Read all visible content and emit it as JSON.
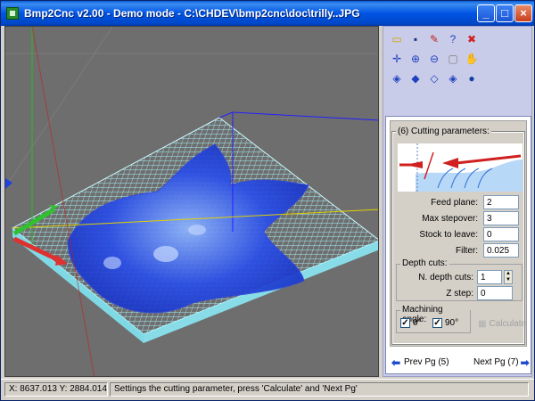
{
  "window": {
    "title": "Bmp2Cnc v2.00 - Demo mode - C:\\CHDEV\\bmp2cnc\\doc\\trilly..JPG",
    "min_icon": "minimize-icon",
    "max_icon": "maximize-icon",
    "close_icon": "close-icon"
  },
  "toolbar": {
    "row1": [
      "open-folder-icon",
      "save-icon",
      "wand-icon",
      "help-icon",
      "stop-icon"
    ],
    "row2": [
      "center-icon",
      "zoom-in-icon",
      "zoom-out-icon",
      "zoom-window-icon",
      "pan-hand-icon"
    ],
    "row3": [
      "view-cube-1-icon",
      "view-cube-2-icon",
      "view-cube-3-icon",
      "view-cube-4-icon",
      "sphere-icon"
    ]
  },
  "params": {
    "title": "(6) Cutting parameters:",
    "feed_plane_label": "Feed plane:",
    "feed_plane_value": "2",
    "max_stepover_label": "Max stepover:",
    "max_stepover_value": "3",
    "stock_label": "Stock to leave:",
    "stock_value": "0",
    "filter_label": "Filter:",
    "filter_value": "0.025",
    "depth_group": "Depth cuts:",
    "n_depth_label": "N. depth cuts:",
    "n_depth_value": "1",
    "z_step_label": "Z step:",
    "z_step_value": "0",
    "angle_group": "Machining angle:",
    "angle_0_label": "0°",
    "angle_90_label": "90°",
    "angle_0_checked": true,
    "angle_90_checked": true,
    "calculate_label": "Calculate"
  },
  "nav": {
    "prev_label": "Prev Pg (5)",
    "next_label": "Next Pg (7)"
  },
  "status": {
    "coords": "X: 8637.013 Y: 2884.014",
    "message": "Settings the cutting parameter, press 'Calculate' and 'Next Pg'"
  },
  "colors": {
    "titlebar": "#0054e3",
    "viewport_bg": "#6e6e6e",
    "mesh": "#9ff0ff",
    "surface": "#1a3cd8",
    "panel_bg": "#c9cce8"
  }
}
